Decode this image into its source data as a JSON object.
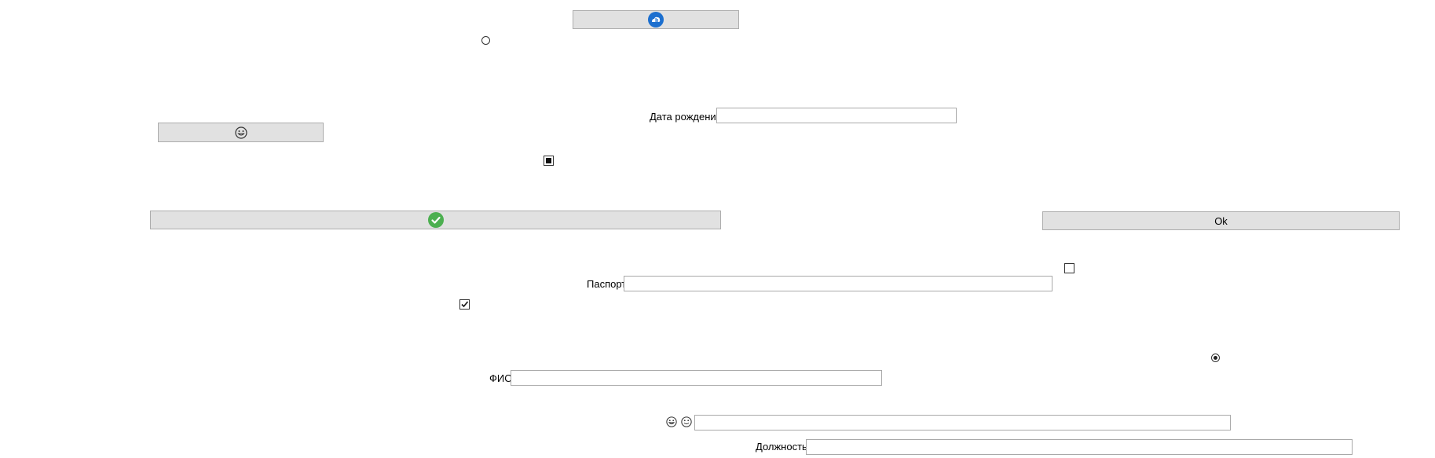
{
  "buttons": {
    "top_icon": {
      "icon": "cloud-upload-icon"
    },
    "smile_icon": {
      "icon": "grinning-face-icon"
    },
    "check_icon": {
      "icon": "checkmark-icon"
    },
    "ok": {
      "label": "Ok"
    }
  },
  "fields": {
    "birth_date": {
      "label": "Дата рождения",
      "value": ""
    },
    "passport": {
      "label": "Паспорт",
      "value": ""
    },
    "fio": {
      "label": "ФИО",
      "value": ""
    },
    "emoji_field": {
      "value": ""
    },
    "position": {
      "label": "Должность",
      "value": ""
    }
  },
  "controls": {
    "radio_top": {
      "checked": false
    },
    "radio_right": {
      "checked": true
    },
    "checkbox_top": {
      "state": "indeterminate"
    },
    "checkbox_right": {
      "state": "unchecked"
    },
    "checkbox_left": {
      "state": "checked"
    }
  },
  "colors": {
    "button_bg": "#e1e1e1",
    "button_border": "#adadad",
    "blue_icon": "#1c6fcf",
    "green_icon": "#4caf50"
  }
}
